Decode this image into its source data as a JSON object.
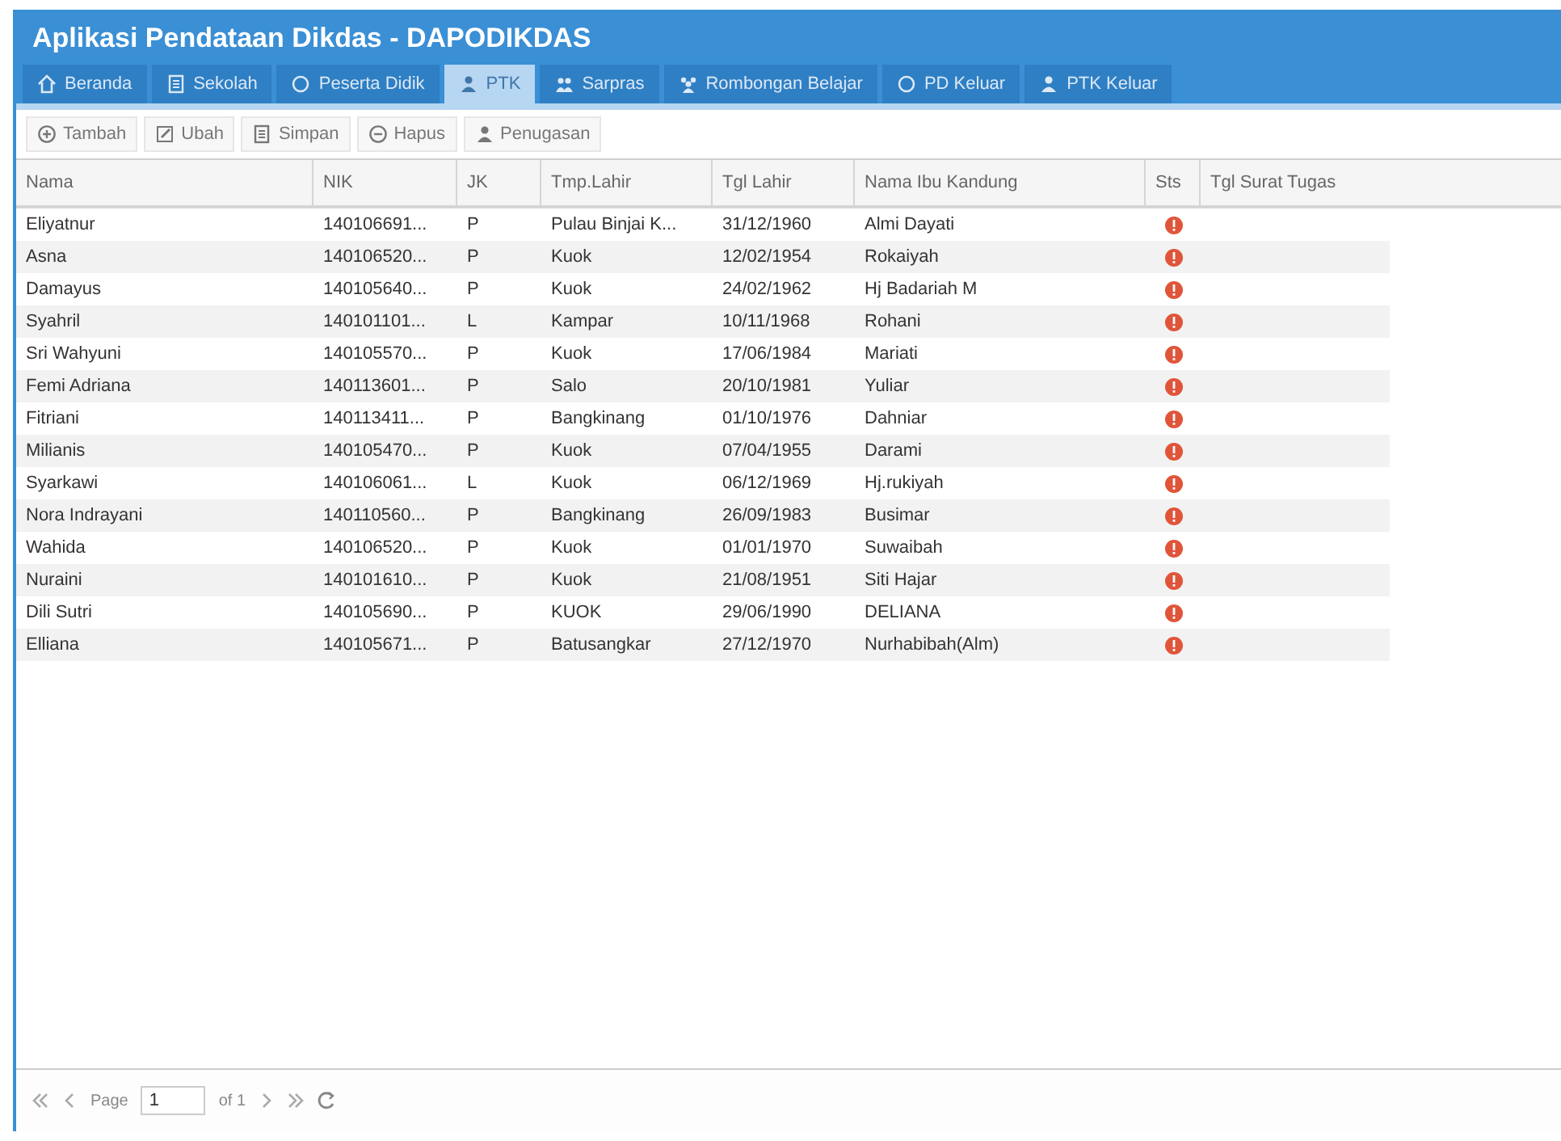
{
  "window": {
    "title": "Aplikasi Pendataan Dikdas - DAPODIKDAS"
  },
  "tabs": [
    {
      "label": "Beranda",
      "selected": false
    },
    {
      "label": "Sekolah",
      "selected": false
    },
    {
      "label": "Peserta Didik",
      "selected": false
    },
    {
      "label": "PTK",
      "selected": true
    },
    {
      "label": "Sarpras",
      "selected": false
    },
    {
      "label": "Rombongan Belajar",
      "selected": false
    },
    {
      "label": "PD Keluar",
      "selected": false
    },
    {
      "label": "PTK Keluar",
      "selected": false
    }
  ],
  "toolbar": [
    {
      "label": "Tambah"
    },
    {
      "label": "Ubah"
    },
    {
      "label": "Simpan"
    },
    {
      "label": "Hapus"
    },
    {
      "label": "Penugasan"
    }
  ],
  "table": {
    "columns": [
      "Nama",
      "NIK",
      "JK",
      "Tmp.Lahir",
      "Tgl Lahir",
      "Nama Ibu Kandung",
      "Sts",
      "Tgl Surat Tugas"
    ],
    "rows": [
      [
        "Eliyatnur",
        "140106691...",
        "P",
        "Pulau Binjai K...",
        "31/12/1960",
        "Almi Dayati"
      ],
      [
        "Asna",
        "140106520...",
        "P",
        "Kuok",
        "12/02/1954",
        "Rokaiyah"
      ],
      [
        "Damayus",
        "140105640...",
        "P",
        "Kuok",
        "24/02/1962",
        "Hj Badariah M"
      ],
      [
        "Syahril",
        "140101101...",
        "L",
        "Kampar",
        "10/11/1968",
        "Rohani"
      ],
      [
        "Sri Wahyuni",
        "140105570...",
        "P",
        "Kuok",
        "17/06/1984",
        "Mariati"
      ],
      [
        "Femi Adriana",
        "140113601...",
        "P",
        "Salo",
        "20/10/1981",
        "Yuliar"
      ],
      [
        "Fitriani",
        "140113411...",
        "P",
        "Bangkinang",
        "01/10/1976",
        "Dahniar"
      ],
      [
        "Milianis",
        "140105470...",
        "P",
        "Kuok",
        "07/04/1955",
        "Darami"
      ],
      [
        "Syarkawi",
        "140106061...",
        "L",
        "Kuok",
        "06/12/1969",
        "Hj.rukiyah"
      ],
      [
        "Nora Indrayani",
        "140110560...",
        "P",
        "Bangkinang",
        "26/09/1983",
        "Busimar"
      ],
      [
        "Wahida",
        "140106520...",
        "P",
        "Kuok",
        "01/01/1970",
        "Suwaibah"
      ],
      [
        "Nuraini",
        "140101610...",
        "P",
        "Kuok",
        "21/08/1951",
        "Siti Hajar"
      ],
      [
        "Dili Sutri",
        "140105690...",
        "P",
        "KUOK",
        "29/06/1990",
        "DELIANA"
      ],
      [
        "Elliana",
        "140105671...",
        "P",
        "Batusangkar",
        "27/12/1970",
        "Nurhabibah(Alm)"
      ]
    ]
  },
  "paging": {
    "page_label": "Page",
    "page": "1",
    "of_label": "of 1"
  }
}
